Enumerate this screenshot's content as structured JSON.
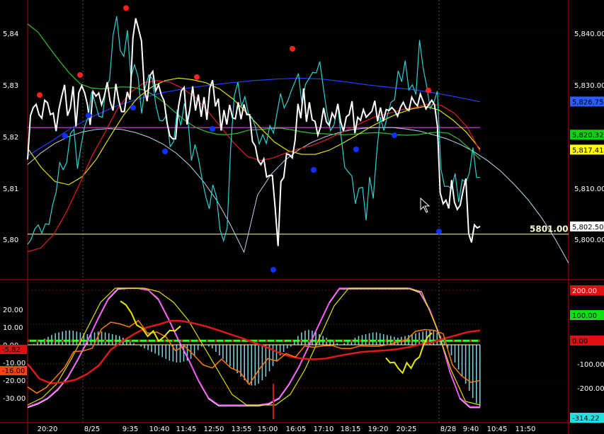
{
  "chart_data": [
    {
      "type": "line",
      "panel": "price",
      "ylim": [
        5797,
        5846
      ],
      "yticks_left": [
        "5,84",
        "5,83",
        "5,82",
        "5,81",
        "5,80"
      ],
      "yticks_right": [
        "5,840.00",
        "5,830.00",
        "5,810.00",
        "5,800.00"
      ],
      "grid": true,
      "reference_line": {
        "value": 5801.0,
        "label": "5801.00",
        "color": "#ffffaa"
      },
      "price_tags": [
        {
          "value": 5826.75,
          "label": "5,826.75",
          "bg": "#2a5cff",
          "fg": "#000000"
        },
        {
          "value": 5820.32,
          "label": "5,820.32",
          "bg": "#10d010",
          "fg": "#000000"
        },
        {
          "value": 5817.41,
          "label": "5,817.41",
          "bg": "#ffff00",
          "fg": "#000000"
        },
        {
          "value": 5802.5,
          "label": "5,802.50",
          "bg": "#ffffff",
          "fg": "#000000"
        }
      ],
      "colors": {
        "price": "#ffffff",
        "fast_line": "#2fd0d0",
        "arc": "#b8d8f0",
        "magenta": "#ff44ff",
        "red": "#e02020",
        "yellow": "#e0e000",
        "green": "#30c030",
        "blue": "#2040ff",
        "dot_red": "#ff2020",
        "dot_blue": "#1030ff"
      },
      "series": [
        {
          "key": "price",
          "values": [
            5815.5,
            5824,
            5825.6,
            5826.2,
            5824.2,
            5823.5,
            5827,
            5826.5,
            5824.2,
            5824.5,
            5821,
            5825.2,
            5827.8,
            5830,
            5824,
            5825.5,
            5829.7,
            5821.9,
            5828.5,
            5829.8,
            5828.5,
            5826.2,
            5822.2,
            5828.7,
            5827.8,
            5828.4,
            5826.1,
            5827.9,
            5830.5,
            5826.8,
            5825,
            5830.2,
            5827,
            5824.8,
            5824.8,
            5828.6,
            5827.1,
            5839.1,
            5842.9,
            5840.8,
            5838.5,
            5829.3,
            5826.8,
            5831.8,
            5832.6,
            5828.8,
            5830,
            5828,
            5826.8,
            5822.6,
            5820.1,
            5819.5,
            5819.5,
            5825.7,
            5828.8,
            5829.5,
            5822.3,
            5825.2,
            5829.7,
            5825,
            5828.1,
            5823.8,
            5827.6,
            5823.2,
            5829.3,
            5830.9,
            5825.8,
            5827.3,
            5821.1,
            5825.1,
            5822.3,
            5826.1,
            5823.6,
            5823.4,
            5826.6,
            5823.3,
            5826.2,
            5824.2,
            5824.2,
            5819,
            5818.1,
            5815.3,
            5814.5,
            5815.6,
            5812.1,
            5812.4,
            5812.4,
            5806.1,
            5798.7,
            5811.2,
            5812,
            5816.6,
            5816.4,
            5815.8,
            5819.3,
            5826.3,
            5823.5,
            5829.3,
            5822.8,
            5826.6,
            5823.2,
            5822.9,
            5820.2,
            5821.9,
            5825.5,
            5822.8,
            5822.1,
            5824.5,
            5823.5,
            5826.3,
            5822.8,
            5821,
            5823.8,
            5824.2,
            5826.8,
            5820.6,
            5823.7,
            5823.1,
            5825.2,
            5823.7,
            5824.3,
            5824.9,
            5826.9,
            5822.9,
            5825.6,
            5822.9,
            5825.2,
            5825,
            5825.6,
            5825,
            5823.9,
            5825.6,
            5826.6,
            5825.4,
            5825,
            5827.6,
            5826.5,
            5825.9,
            5828.2,
            5826.8,
            5825.3,
            5826.2,
            5827,
            5826.1,
            5822,
            5809,
            5806.9,
            5807.6,
            5806,
            5811.5,
            5807.2,
            5805.8,
            5806.6,
            5809.4,
            5811.8,
            5801.1,
            5799.4,
            5802.8,
            5802.2,
            5802.5
          ]
        },
        {
          "key": "fast_line",
          "values": [
            5799,
            5800,
            5802,
            5802.8,
            5801.2,
            5803,
            5802.9,
            5806.6,
            5809.2,
            5814.9,
            5813.5,
            5815,
            5820.5,
            5821.4,
            5813.7,
            5818.2,
            5821.9,
            5823.7,
            5828.7,
            5826.4,
            5823.9,
            5823.7,
            5829.7,
            5830.9,
            5839.7,
            5843.3,
            5836.7,
            5835.5,
            5840.6,
            5831.4,
            5833.9,
            5831.6,
            5824.4,
            5829.4,
            5831.9,
            5831.2,
            5826.1,
            5823.1,
            5823,
            5824.1,
            5818,
            5819,
            5825.2,
            5822.1,
            5826.4,
            5823.2,
            5815.3,
            5818.4,
            5815.5,
            5811.6,
            5808.3,
            5805.9,
            5810.6,
            5808.3,
            5801.9,
            5799.7,
            5802.2,
            5817.9,
            5827.8,
            5830.5,
            5825.8,
            5827.7,
            5824.3,
            5823.6,
            5821.7,
            5818.5,
            5820.3,
            5818.6,
            5822.1,
            5820.6,
            5824.5,
            5828.3,
            5825.5,
            5826.8,
            5828.8,
            5830.5,
            5832.2,
            5826.3,
            5830.1,
            5831.2,
            5832.4,
            5832.3,
            5834.5,
            5829.5,
            5824.7,
            5821.1,
            5822.2,
            5826.3,
            5819.9,
            5814,
            5813.1,
            5812.3,
            5806.9,
            5809.9,
            5810.1,
            5803.7,
            5812.1,
            5807.9,
            5817,
            5823.8,
            5821.1,
            5824.1,
            5826.6,
            5827.1,
            5832.7,
            5830.6,
            5834.7,
            5829,
            5830,
            5828.1,
            5838.7,
            5833.3,
            5829.8,
            5825.4,
            5826.5,
            5828.8,
            5813.7,
            5810.3,
            5810.3,
            5809.9,
            5812.8,
            5807.2,
            5811.6,
            5811,
            5812.9,
            5817.8,
            5812,
            5812
          ]
        },
        {
          "key": "arc",
          "values": [
            5814.5,
            5816.8,
            5818.6,
            5819.9,
            5820.8,
            5821.3,
            5821.5,
            5821.3,
            5820.7,
            5819.8,
            5818.5,
            5816.7,
            5814.3,
            5811.2,
            5807.5,
            5802.8,
            5797.5,
            5808.6,
            5812.6,
            5815.3,
            5817.3,
            5818.8,
            5819.9,
            5820.7,
            5821.3,
            5821.6,
            5821.7,
            5821.7,
            5821.4,
            5821,
            5820.3,
            5819.5,
            5818.4,
            5817,
            5815.3,
            5813.2,
            5810.6,
            5807.7,
            5804.2,
            5800.1,
            5795.4
          ]
        },
        {
          "key": "blue",
          "values": [
            5816.2,
            5818.9,
            5821.8,
            5824.1,
            5826,
            5827.4,
            5828.5,
            5829.3,
            5829.9,
            5830.4,
            5830.8,
            5831.1,
            5831.3,
            5831.1,
            5830.6,
            5830,
            5829.5,
            5829.1,
            5828.4,
            5827.6,
            5826.7
          ]
        },
        {
          "key": "green",
          "values": [
            5841.8,
            5840.2,
            5837.4,
            5834.7,
            5832.2,
            5830.2,
            5829.4,
            5829.2,
            5829.4,
            5829.6,
            5829.5,
            5829,
            5828,
            5826.5,
            5824.7,
            5823,
            5821.7,
            5820.9,
            5820.4,
            5820.3,
            5820.6,
            5821.2,
            5821.3,
            5821.5,
            5821.6,
            5821.3,
            5820.9,
            5820.6,
            5820.5,
            5820.4,
            5820.3,
            5820.4,
            5820.6,
            5820.7,
            5820.6,
            5820.3,
            5820.2,
            5820.3,
            5820.6,
            5820.8,
            5820.6,
            5819.4,
            5817.6,
            5815.5
          ]
        },
        {
          "key": "yellow",
          "values": [
            5817.7,
            5813.9,
            5811.2,
            5810.6,
            5812.2,
            5815.5,
            5819.9,
            5824.1,
            5827.4,
            5829.5,
            5830.8,
            5831.3,
            5831,
            5830.4,
            5829.2,
            5827.2,
            5824.5,
            5821.6,
            5818.9,
            5817.2,
            5816.5,
            5816.5,
            5817.3,
            5818.7,
            5820.2,
            5821.8,
            5823.2,
            5824.4,
            5825.3,
            5825.8,
            5825.1,
            5823.2,
            5820.8,
            5817.5
          ]
        },
        {
          "key": "red",
          "values": [
            5797.6,
            5798.3,
            5800.9,
            5805.3,
            5810.6,
            5816.3,
            5820.8,
            5825.6,
            5828.6,
            5830.4,
            5830.8,
            5830.5,
            5829.3,
            5827.5,
            5824.7,
            5821.6,
            5818.6,
            5816.1,
            5815.3,
            5815.8,
            5816.8,
            5817.6,
            5818.2,
            5819.2,
            5820.4,
            5821.6,
            5822.8,
            5823.9,
            5824.5,
            5825.2,
            5825.6,
            5826.3,
            5826,
            5824.5,
            5821.8,
            5817.1
          ]
        },
        {
          "key": "dots_red",
          "values": [
            5828,
            5831.9,
            5844.9,
            5831.5,
            5837,
            5828.9
          ]
        },
        {
          "key": "dots_blue",
          "values": [
            5820.7,
            5824.8,
            5825.6,
            5821.5,
            5817.2,
            5821.8,
            5794.1,
            5815,
            5817.7,
            5820.9,
            5802.6
          ]
        }
      ]
    },
    {
      "type": "bar",
      "panel": "oscillator",
      "ylim": [
        -36,
        36
      ],
      "yticks_left": [
        "20.00",
        "10.00",
        "0.00",
        "-10.00",
        "-20.00",
        "-30.00"
      ],
      "yticks_right": [
        "100.00",
        "-100.00",
        "-200.00"
      ],
      "left_tags": [
        {
          "label": "-5.82",
          "bg": "#e01010",
          "fg": "#000000"
        },
        {
          "label": "-16.00",
          "bg": "#ff4010",
          "fg": "#000000"
        }
      ],
      "right_tags": [
        {
          "label": "200.00",
          "bg": "#e01010",
          "fg": "#ffffff"
        },
        {
          "label": "100.00",
          "bg": "#10e010",
          "fg": "#000000"
        },
        {
          "label": "0.00",
          "bg": "#e01010",
          "fg": "#000000"
        },
        {
          "label": "-314.22",
          "bg": "#20e0e0",
          "fg": "#000000"
        }
      ],
      "colors": {
        "histogram": "#7ec8d8",
        "zero_line": "#30ff30",
        "red_line": "#e01818",
        "orange": "#ff7a00",
        "yellow_line": "#e8e800",
        "magenta": "#ff40ff",
        "white": "#ffffff",
        "stoch_yellow": "#e0e000"
      },
      "series": [
        {
          "key": "histogram",
          "values": [
            0,
            0.5,
            1.5,
            2.5,
            3.5,
            4.5,
            5.5,
            6.5,
            7,
            7.5,
            8,
            8.2,
            8,
            7.5,
            7,
            6.5,
            6,
            6.5,
            7,
            7.5,
            7.5,
            7,
            6.5,
            6,
            5.5,
            5,
            4,
            3,
            2,
            1,
            0,
            -1,
            -2,
            -3,
            -4,
            -5,
            -6,
            -7,
            -8,
            -9,
            -9.5,
            -10,
            -10,
            -9.5,
            -9,
            -8,
            -6,
            -3,
            -1,
            0,
            -1,
            -2,
            -4,
            -6,
            -8,
            -10,
            -12,
            -14,
            -16,
            -18,
            -20,
            -22,
            -23,
            -23,
            -22,
            -20,
            -18,
            -15,
            -12,
            -9,
            -6,
            -4,
            -2,
            -1,
            2,
            5,
            7,
            8,
            8.5,
            8,
            7,
            6,
            5,
            4,
            3,
            2,
            1,
            0,
            1,
            2,
            3,
            4,
            5,
            5.5,
            6,
            6.5,
            7,
            7,
            6.5,
            6,
            5.5,
            5,
            4.5,
            4,
            4.5,
            5,
            5.5,
            6,
            6.5,
            7,
            7.5,
            8,
            8.5,
            8,
            7,
            5,
            2,
            -2,
            -6,
            -10,
            -14,
            -18,
            -22,
            -26,
            -30,
            -33,
            -35
          ]
        },
        {
          "key": "red_line",
          "values": [
            -10.8,
            -19.2,
            -21.8,
            -21.2,
            -19.8,
            -16.5,
            -11.5,
            -2.7,
            2.2,
            6.3,
            9.8,
            11.5,
            13.6,
            13.4,
            12.1,
            10.4,
            8.3,
            6,
            3.8,
            1.3,
            -1.1,
            -4.1,
            -6.5,
            -7.8,
            -8.2,
            -7.8,
            -6.4,
            -5.2,
            -4.1,
            -3.6,
            -3.2,
            -2.5,
            -1.3,
            0.2,
            1.4,
            3.6,
            5.4,
            7.3,
            8.1
          ]
        },
        {
          "key": "orange",
          "values": [
            -23.8,
            -27.3,
            -24.2,
            -18.6,
            -12.8,
            -3.8,
            -3.5,
            -1.9,
            8.9,
            12.8,
            11.8,
            10.1,
            13.7,
            6.5,
            7.2,
            4.4,
            -3.3,
            -0.7,
            -5.8,
            -11.3,
            -13.1,
            -8.1,
            -13,
            -15.3,
            -22.4,
            -14.4,
            -7.8,
            -9.2,
            -4.9,
            -7,
            -0.7,
            -1.4,
            -0.6,
            -0.4,
            -2.1,
            -2.1,
            -0.6,
            -0.8,
            -0.8,
            0,
            1.4,
            2.7,
            7.6,
            8.6,
            8.2,
            6.3,
            -11.4,
            -17.6,
            -21.2,
            -20.1
          ]
        },
        {
          "key": "yellow_line",
          "values": [
            24.7,
            22.6,
            18,
            11.1,
            9.3,
            4.8,
            7.8,
            2.1,
            4.6,
            8.1,
            7.9,
            10.6
          ]
        },
        {
          "key": "magenta",
          "values": [
            -35,
            -33,
            -30,
            -25,
            -18,
            -8,
            3,
            15,
            26,
            32,
            32,
            32,
            31,
            26,
            15,
            3,
            -8,
            -20,
            -30,
            -34,
            -34,
            -34,
            -34,
            -34,
            -33,
            -30,
            -22,
            -12,
            0,
            12,
            24,
            32,
            32,
            32,
            32,
            32,
            32,
            32,
            32,
            30,
            20,
            5,
            -15,
            -30,
            -35,
            -35
          ]
        },
        {
          "key": "white",
          "values": [
            -35.5,
            -33.5,
            -30.5,
            -25.5,
            -18.5,
            -8.5,
            2.5,
            14.5,
            25.5,
            31.5,
            31.8,
            31.8,
            30.8,
            25.5,
            14.5,
            2.5,
            -8.5,
            -20.5,
            -30.5,
            -34.5,
            -34.5,
            -34.5,
            -34.5,
            -34.5,
            -33.5,
            -30.5,
            -22.5,
            -12.5,
            -0.5,
            11.5,
            23.5,
            31.6,
            31.6,
            31.6,
            31.6,
            31.6,
            31.6,
            31.6,
            31.6,
            29.5,
            19.5,
            4.5,
            -15.5,
            -30.5,
            -35.5,
            -35.5
          ]
        },
        {
          "key": "stoch_yellow",
          "values": [
            -34,
            -30,
            -22,
            -8,
            8,
            24,
            32,
            32,
            32,
            30,
            24,
            14,
            0,
            -14,
            -28,
            -34,
            -34,
            -34,
            -28,
            -14,
            4,
            22,
            32,
            32,
            32,
            32,
            32,
            30,
            10,
            -14,
            -32,
            -34
          ]
        }
      ]
    }
  ],
  "xaxis": {
    "labels": [
      "20:20",
      "8/25",
      "9:35",
      "10:40",
      "11:45",
      "12:50",
      "13:55",
      "15:00",
      "16:05",
      "17:10",
      "18:15",
      "19:20",
      "20:25",
      "8/28",
      "9:40",
      "10:45",
      "11:50"
    ]
  }
}
